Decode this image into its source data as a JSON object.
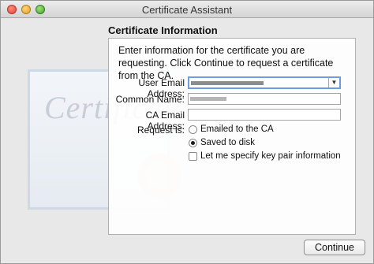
{
  "window": {
    "title": "Certificate Assistant"
  },
  "panel": {
    "title": "Certificate Information",
    "intro": "Enter information for the certificate you are requesting. Click Continue to request a certificate from the CA."
  },
  "form": {
    "user_email_label": "User Email Address:",
    "common_name_label": "Common Name:",
    "ca_email_label": "CA Email Address:",
    "ca_email_value": "",
    "request_label": "Request is:",
    "options": [
      {
        "label": "Emailed to the CA",
        "selected": false
      },
      {
        "label": "Saved to disk",
        "selected": true
      }
    ],
    "keypair_label": "Let me specify key pair information",
    "keypair_checked": false
  },
  "buttons": {
    "continue": "Continue"
  },
  "decor": {
    "certificate_script": "Certificate"
  }
}
